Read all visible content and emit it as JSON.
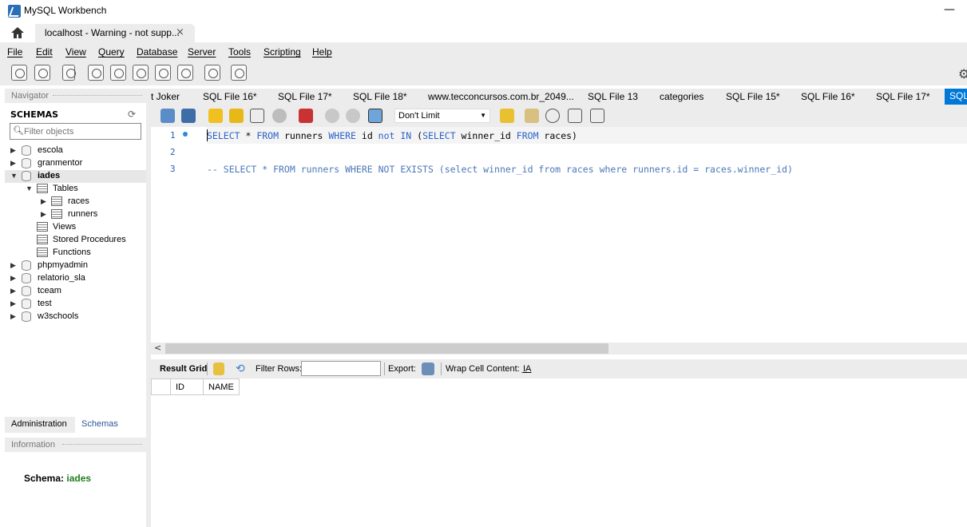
{
  "window": {
    "title": "MySQL Workbench"
  },
  "connection_tab": {
    "label": "localhost - Warning - not supp...",
    "close": "×"
  },
  "menu": [
    "File",
    "Edit",
    "View",
    "Query",
    "Database",
    "Server",
    "Tools",
    "Scripting",
    "Help"
  ],
  "navigator": {
    "header": "Navigator",
    "schemas_title": "SCHEMAS",
    "filter_placeholder": "Filter objects",
    "schemas": [
      "escola",
      "granmentor",
      "iades",
      "phpmyadmin",
      "relatorio_sla",
      "tceam",
      "test",
      "w3schools"
    ],
    "iades_children": {
      "tables": "Tables",
      "table_items": [
        "races",
        "runners"
      ],
      "views": "Views",
      "stored_procedures": "Stored Procedures",
      "functions": "Functions"
    },
    "tabs": [
      "Administration",
      "Schemas"
    ],
    "info_header": "Information",
    "info_schema_label": "Schema:",
    "info_schema_value": "iades"
  },
  "editor_tabs": [
    "t Joker",
    "SQL File 16*",
    "SQL File 17*",
    "SQL File 18*",
    "www.tecconcursos.com.br_2049...",
    "SQL File 13",
    "categories",
    "SQL File 15*",
    "SQL File 16*",
    "SQL File 17*"
  ],
  "editor_tab_active": "SQL",
  "sql_toolbar": {
    "limit": "Don't Limit"
  },
  "code_lines": {
    "l1": "1",
    "l2": "2",
    "l3": "3"
  },
  "result_toolbar": {
    "result_grid": "Result Grid",
    "filter_rows": "Filter Rows:",
    "export": "Export:",
    "wrap": "Wrap Cell Content:"
  },
  "grid_columns": [
    "ID",
    "NAME"
  ]
}
